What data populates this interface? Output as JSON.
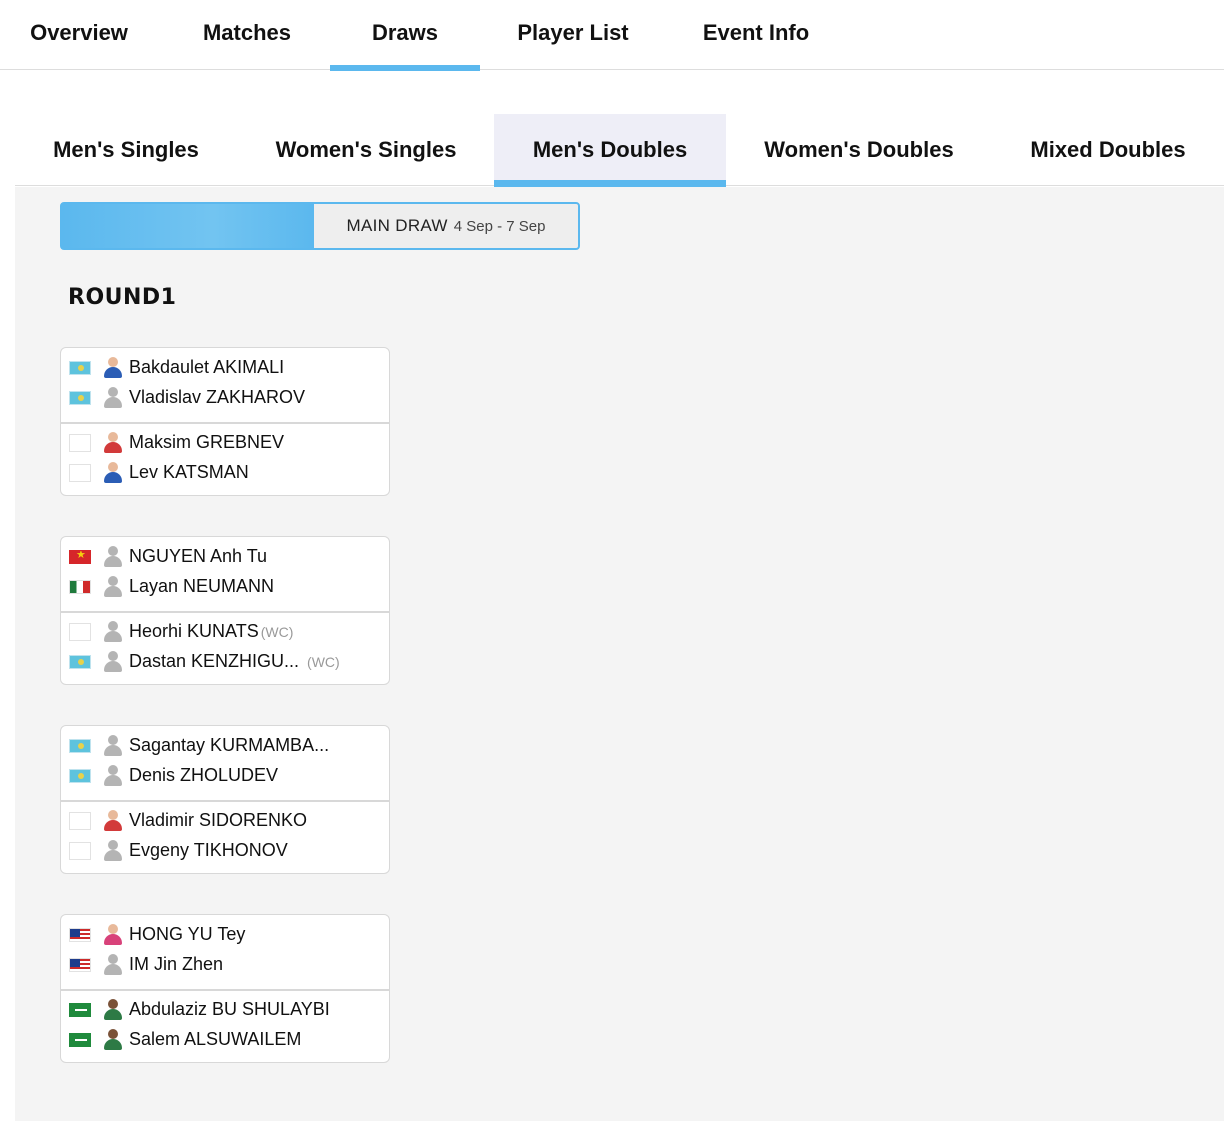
{
  "top_nav": {
    "tabs": [
      {
        "label": "Overview"
      },
      {
        "label": "Matches"
      },
      {
        "label": "Draws"
      },
      {
        "label": "Player List"
      },
      {
        "label": "Event Info"
      }
    ],
    "active": "Draws"
  },
  "event_tabs": {
    "tabs": [
      {
        "label": "Men's Singles"
      },
      {
        "label": "Women's Singles"
      },
      {
        "label": "Men's Doubles"
      },
      {
        "label": "Women's Doubles"
      },
      {
        "label": "Mixed Doubles"
      }
    ],
    "active": "Men's Doubles"
  },
  "draw_selector": {
    "label": "MAIN DRAW",
    "dates": "4 Sep - 7 Sep"
  },
  "round_title": "ROUND1",
  "matches": [
    {
      "team1": [
        {
          "name": "Bakdaulet AKIMALI",
          "flag": "kazakhstan-flag",
          "avatar": "player-photo"
        },
        {
          "name": "Vladislav ZAKHAROV",
          "flag": "kazakhstan-flag",
          "avatar": "placeholder-avatar"
        }
      ],
      "team2": [
        {
          "name": "Maksim GREBNEV",
          "flag": "empty-flag",
          "avatar": "player-photo"
        },
        {
          "name": "Lev KATSMAN",
          "flag": "empty-flag",
          "avatar": "player-photo"
        }
      ]
    },
    {
      "team1": [
        {
          "name": "NGUYEN Anh Tu",
          "flag": "vietnam-flag",
          "avatar": "placeholder-avatar"
        },
        {
          "name": "Layan NEUMANN",
          "flag": "mexico-flag",
          "avatar": "placeholder-avatar"
        }
      ],
      "team2": [
        {
          "name": "Heorhi KUNATS",
          "tag": "(WC)",
          "flag": "empty-flag",
          "avatar": "placeholder-avatar"
        },
        {
          "name": "Dastan KENZHIGU...",
          "tag": "(WC)",
          "flag": "kazakhstan-flag",
          "avatar": "placeholder-avatar"
        }
      ]
    },
    {
      "team1": [
        {
          "name": "Sagantay KURMAMBA...",
          "flag": "kazakhstan-flag",
          "avatar": "placeholder-avatar"
        },
        {
          "name": "Denis ZHOLUDEV",
          "flag": "kazakhstan-flag",
          "avatar": "placeholder-avatar"
        }
      ],
      "team2": [
        {
          "name": "Vladimir SIDORENKO",
          "flag": "empty-flag",
          "avatar": "player-photo"
        },
        {
          "name": "Evgeny TIKHONOV",
          "flag": "empty-flag",
          "avatar": "placeholder-avatar"
        }
      ]
    },
    {
      "team1": [
        {
          "name": "HONG YU Tey",
          "flag": "malaysia-flag",
          "avatar": "player-photo"
        },
        {
          "name": "IM Jin Zhen",
          "flag": "malaysia-flag",
          "avatar": "placeholder-avatar"
        }
      ],
      "team2": [
        {
          "name": "Abdulaziz BU SHULAYBI",
          "flag": "saudi-arabia-flag",
          "avatar": "player-photo"
        },
        {
          "name": "Salem ALSUWAILEM",
          "flag": "saudi-arabia-flag",
          "avatar": "player-photo"
        }
      ]
    }
  ],
  "colors": {
    "accent": "#5bb8ee",
    "active_tab_bg": "#eeeef7",
    "draw_bg": "#f4f4f4",
    "text": "#111111",
    "muted": "#999999"
  }
}
